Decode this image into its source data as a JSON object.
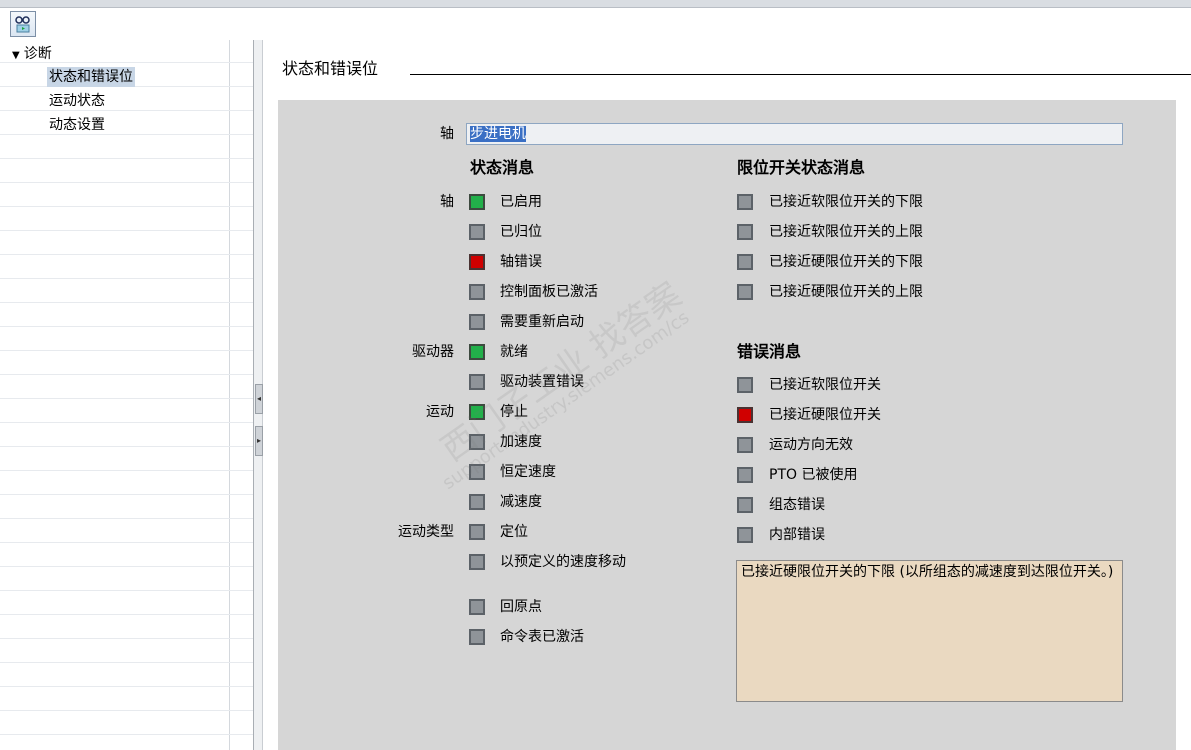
{
  "tree": {
    "root_label": "诊断",
    "items": [
      {
        "label": "状态和错误位",
        "selected": true
      },
      {
        "label": "运动状态",
        "selected": false
      },
      {
        "label": "动态设置",
        "selected": false
      }
    ]
  },
  "content": {
    "section_title": "状态和错误位",
    "axis_label": "轴",
    "axis_value": "步进电机",
    "status_heading": "状态消息",
    "limit_heading": "限位开关状态消息",
    "error_heading": "错误消息",
    "group_labels": {
      "axis": "轴",
      "drive": "驱动器",
      "motion": "运动",
      "motion_type": "运动类型"
    },
    "status_items": [
      {
        "label": "已启用",
        "state": "green"
      },
      {
        "label": "已归位",
        "state": "off"
      },
      {
        "label": "轴错误",
        "state": "red"
      },
      {
        "label": "控制面板已激活",
        "state": "off"
      },
      {
        "label": "需要重新启动",
        "state": "off"
      },
      {
        "label": "就绪",
        "state": "green"
      },
      {
        "label": "驱动装置错误",
        "state": "off"
      },
      {
        "label": "停止",
        "state": "green"
      },
      {
        "label": "加速度",
        "state": "off"
      },
      {
        "label": "恒定速度",
        "state": "off"
      },
      {
        "label": "减速度",
        "state": "off"
      },
      {
        "label": "定位",
        "state": "off"
      },
      {
        "label": "以预定义的速度移动",
        "state": "off"
      },
      {
        "label": "回原点",
        "state": "off"
      },
      {
        "label": "命令表已激活",
        "state": "off"
      }
    ],
    "limit_items": [
      {
        "label": "已接近软限位开关的下限",
        "state": "off"
      },
      {
        "label": "已接近软限位开关的上限",
        "state": "off"
      },
      {
        "label": "已接近硬限位开关的下限",
        "state": "off"
      },
      {
        "label": "已接近硬限位开关的上限",
        "state": "off"
      }
    ],
    "error_items": [
      {
        "label": "已接近软限位开关",
        "state": "off"
      },
      {
        "label": "已接近硬限位开关",
        "state": "red"
      },
      {
        "label": "运动方向无效",
        "state": "off"
      },
      {
        "label": "PTO 已被使用",
        "state": "off"
      },
      {
        "label": "组态错误",
        "state": "off"
      },
      {
        "label": "内部错误",
        "state": "off"
      }
    ],
    "message_text": "已接近硬限位开关的下限 (以所组态的减速度到达限位开关。)"
  },
  "watermark": {
    "line1": "西门子工业 找答案",
    "line2": "support.industry.siemens.com/cs"
  },
  "colors": {
    "indicator_green": "#22b04a",
    "indicator_red": "#d00000",
    "indicator_off": "#8f9499",
    "panel_bg": "#d6d6d6",
    "message_bg": "#ead9c1"
  },
  "icons": {
    "toolbar_button": "monitor-glasses-icon",
    "tree_caret": "caret-down-icon",
    "splitter_left": "arrow-left-icon",
    "splitter_right": "arrow-right-icon"
  }
}
